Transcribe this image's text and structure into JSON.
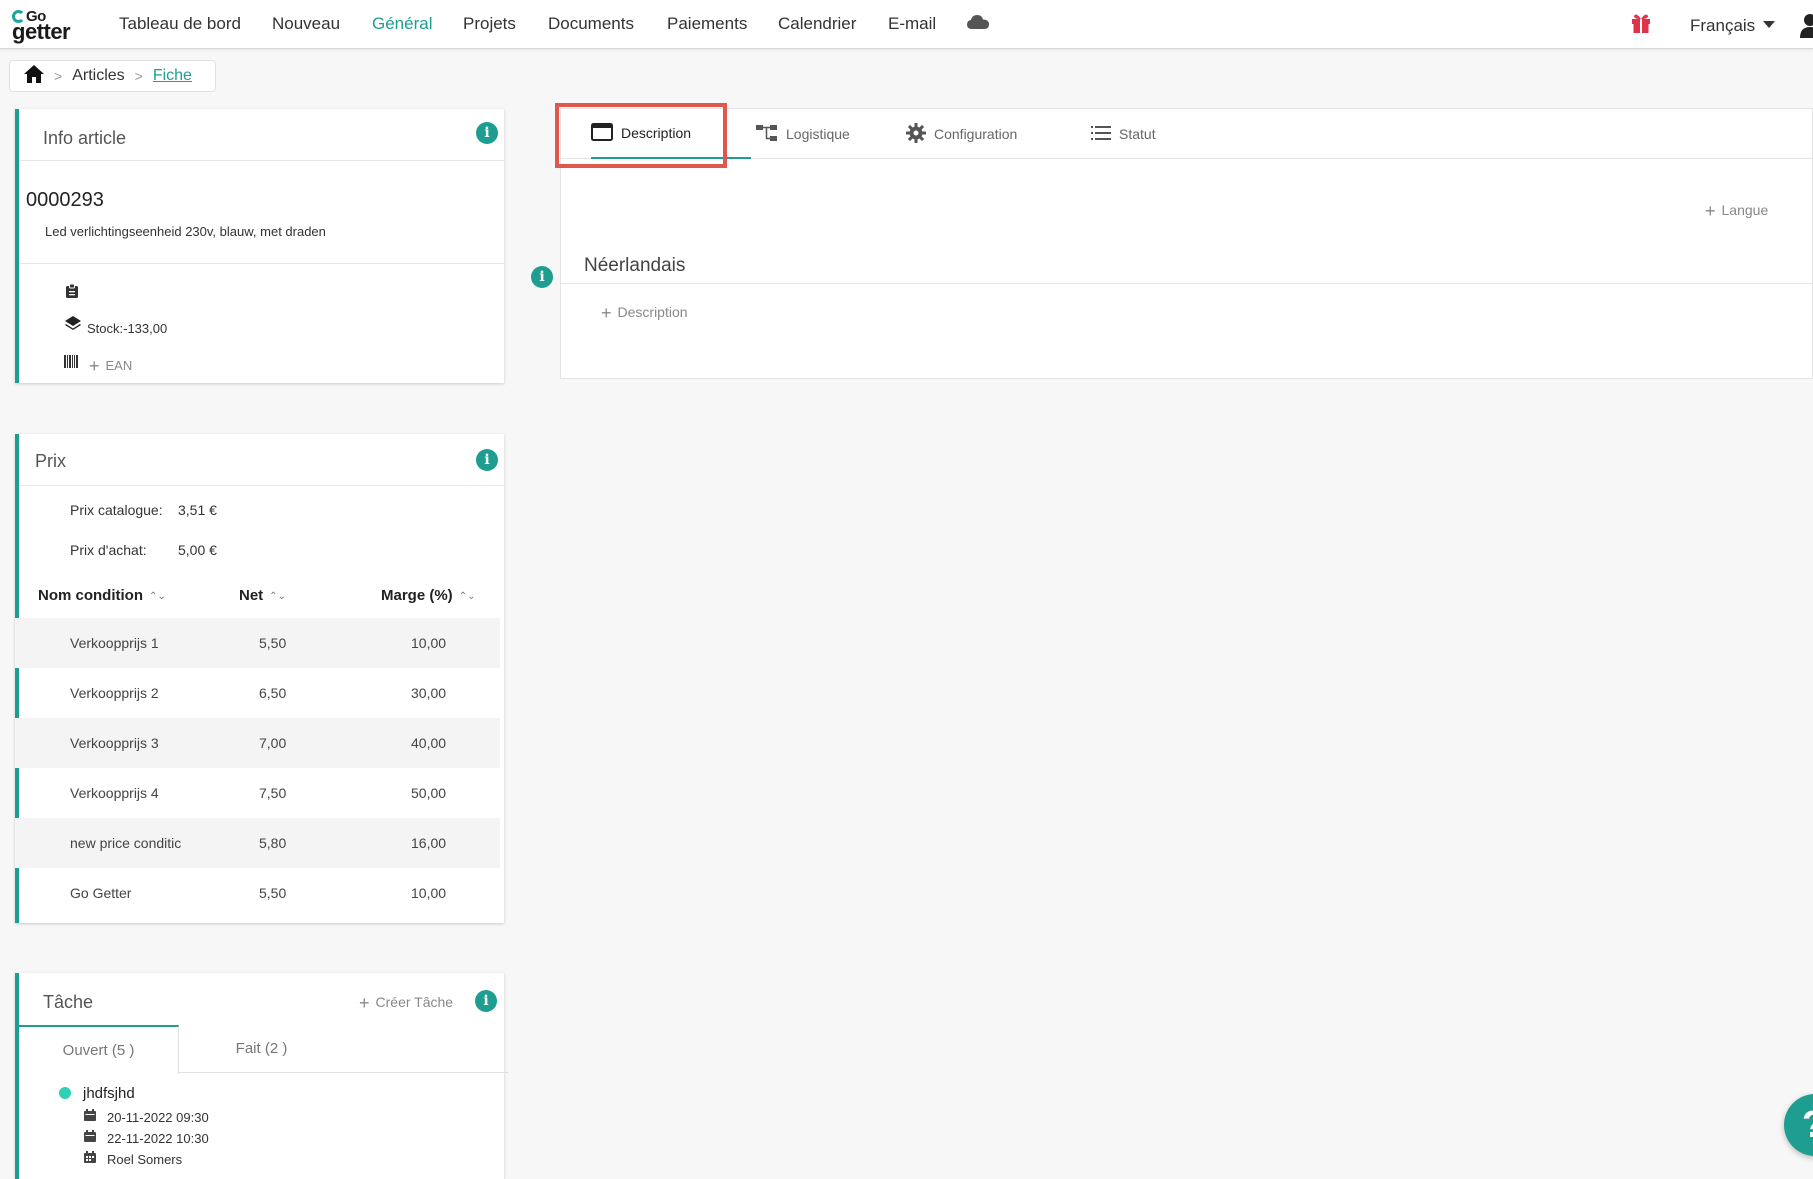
{
  "brand": {
    "logo_top": "Go",
    "logo_bottom": "getter"
  },
  "nav": {
    "items": [
      "Tableau de bord",
      "Nouveau",
      "Général",
      "Projets",
      "Documents",
      "Paiements",
      "Calendrier",
      "E-mail"
    ],
    "active": "Général",
    "language": "Français"
  },
  "breadcrumb": {
    "items": [
      "Articles",
      "Fiche"
    ]
  },
  "info_article": {
    "title": "Info article",
    "code": "0000293",
    "description": "Led verlichtingseenheid 230v, blauw, met draden",
    "stock_label": "Stock:-133,00",
    "ean_label": "EAN"
  },
  "prix": {
    "title": "Prix",
    "catalogue_label": "Prix catalogue:",
    "catalogue_value": "3,51 €",
    "achat_label": "Prix d'achat:",
    "achat_value": "5,00 €",
    "columns": [
      "Nom condition",
      "Net",
      "Marge (%)"
    ],
    "rows": [
      {
        "name": "Verkoopprijs 1",
        "net": "5,50",
        "marge": "10,00"
      },
      {
        "name": "Verkoopprijs 2",
        "net": "6,50",
        "marge": "30,00"
      },
      {
        "name": "Verkoopprijs 3",
        "net": "7,00",
        "marge": "40,00"
      },
      {
        "name": "Verkoopprijs 4",
        "net": "7,50",
        "marge": "50,00"
      },
      {
        "name": "new price conditic",
        "net": "5,80",
        "marge": "16,00"
      },
      {
        "name": "Go Getter",
        "net": "5,50",
        "marge": "10,00"
      }
    ]
  },
  "tache": {
    "title": "Tâche",
    "create_label": "Créer Tâche",
    "tabs": [
      "Ouvert (5 )",
      "Fait (2 )"
    ],
    "items": [
      {
        "name": "jhdfsjhd",
        "start": "20-11-2022 09:30",
        "end": "22-11-2022 10:30",
        "user": "Roel Somers"
      }
    ]
  },
  "right": {
    "tabs": [
      "Description",
      "Logistique",
      "Configuration",
      "Statut"
    ],
    "active_tab": "Description",
    "add_language_label": "Langue",
    "language_title": "Néerlandais",
    "add_description_label": "Description"
  },
  "colors": {
    "accent": "#1e9e91",
    "highlight": "#e2574c",
    "gift": "#e0334a"
  }
}
